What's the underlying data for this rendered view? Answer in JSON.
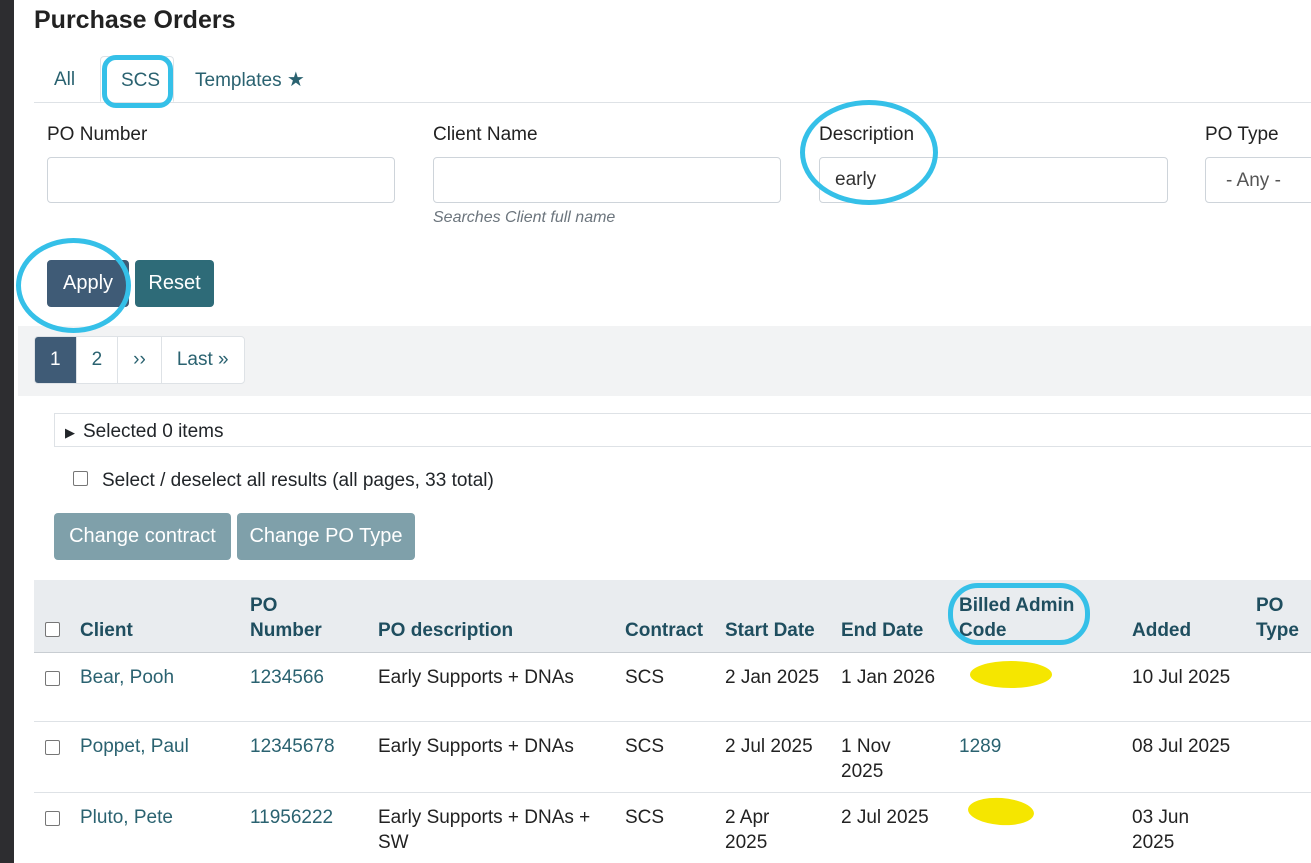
{
  "page": {
    "title": "Purchase Orders"
  },
  "tabs": [
    {
      "label": "All"
    },
    {
      "label": "SCS"
    },
    {
      "label": "Templates",
      "icon": "star-icon"
    }
  ],
  "filters": {
    "po_number": {
      "label": "PO Number",
      "value": ""
    },
    "client_name": {
      "label": "Client Name",
      "value": "",
      "help": "Searches Client full name"
    },
    "description": {
      "label": "Description",
      "value": "early"
    },
    "po_type": {
      "label": "PO Type",
      "value": "- Any -"
    }
  },
  "buttons": {
    "apply": "Apply",
    "reset": "Reset",
    "change_contract": "Change contract",
    "change_po_type": "Change PO Type"
  },
  "pager": [
    "1",
    "2",
    "››",
    "Last »"
  ],
  "selection": {
    "summary": "Selected 0 items",
    "select_all": "Select / deselect all results (all pages, 33 total)"
  },
  "table": {
    "headers": {
      "client": "Client",
      "po_number_1": "PO",
      "po_number_2": "Number",
      "po_description": "PO description",
      "contract": "Contract",
      "start_date": "Start Date",
      "end_date": "End Date",
      "billed_1": "Billed Admin",
      "billed_2": "Code",
      "added": "Added",
      "po_type_1": "PO",
      "po_type_2": "Type"
    },
    "rows": [
      {
        "client": "Bear, Pooh",
        "po_number": "1234566",
        "desc1": "Early Supports + DNAs",
        "desc2": "",
        "contract": "SCS",
        "start1": "2 Jan 2025",
        "start2": "",
        "end1": "1 Jan 2026",
        "end2": "",
        "billed": "",
        "added1": "10 Jul 2025",
        "added2": ""
      },
      {
        "client": "Poppet, Paul",
        "po_number": "12345678",
        "desc1": "Early Supports + DNAs",
        "desc2": "",
        "contract": "SCS",
        "start1": "2 Jul 2025",
        "start2": "",
        "end1": "1 Nov",
        "end2": "2025",
        "billed": "1289",
        "added1": "08 Jul 2025",
        "added2": ""
      },
      {
        "client": "Pluto, Pete",
        "po_number": "11956222",
        "desc1": "Early Supports + DNAs +",
        "desc2": "SW",
        "contract": "SCS",
        "start1": "2 Apr",
        "start2": "2025",
        "end1": "2 Jul 2025",
        "end2": "",
        "billed": "",
        "added1": "03 Jun",
        "added2": "2025"
      }
    ]
  },
  "annotations": {
    "circle_color": "#35c0e8",
    "redaction_color": "#f5e600"
  }
}
